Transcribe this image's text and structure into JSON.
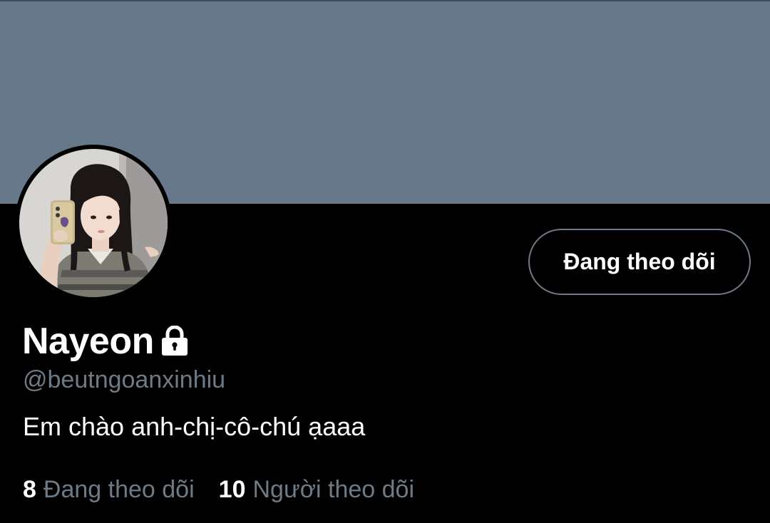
{
  "profile": {
    "display_name": "Nayeon",
    "handle": "@beutngoanxinhiu",
    "bio": "Em chào anh-chị-cô-chú ạaaa",
    "follow_button_label": "Đang theo dõi",
    "stats": {
      "following_count": "8",
      "following_label": "Đang theo dõi",
      "followers_count": "10",
      "followers_label": "Người theo dõi"
    }
  },
  "icons": {
    "lock": "lock-icon",
    "avatar": "avatar-photo"
  },
  "colors": {
    "banner": "#66788a",
    "background": "#000000",
    "muted_text": "#6e7b86",
    "button_border": "#6e7b86",
    "text": "#ffffff"
  }
}
